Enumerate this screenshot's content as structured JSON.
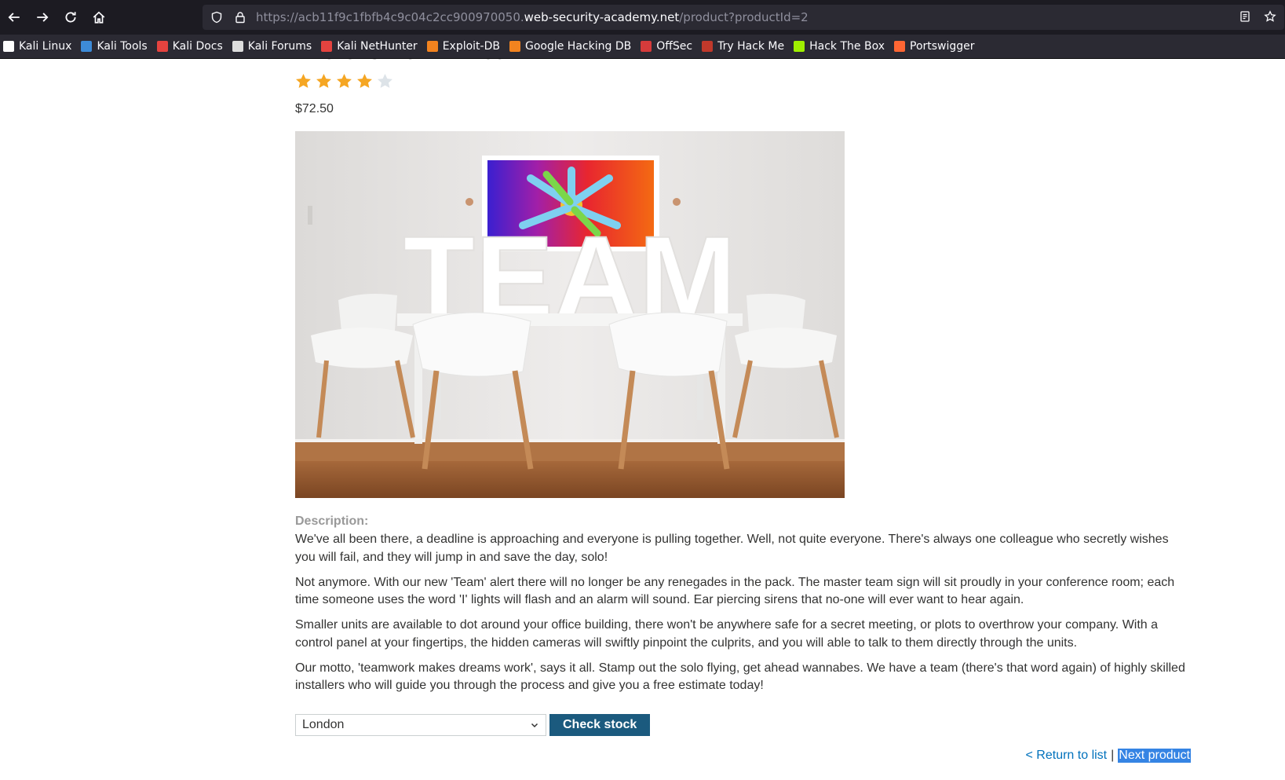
{
  "browser": {
    "url_prefix": "https://acb11f9c1fbfb4c9c04c2cc900970050.",
    "url_host": "web-security-academy.net",
    "url_path": "/product?productId=2",
    "bookmarks": [
      {
        "label": "Kali Linux",
        "color": "#ffffff"
      },
      {
        "label": "Kali Tools",
        "color": "#3d8bd8"
      },
      {
        "label": "Kali Docs",
        "color": "#e5433f"
      },
      {
        "label": "Kali Forums",
        "color": "#dddddd"
      },
      {
        "label": "Kali NetHunter",
        "color": "#e5433f"
      },
      {
        "label": "Exploit-DB",
        "color": "#f2831f"
      },
      {
        "label": "Google Hacking DB",
        "color": "#f2831f"
      },
      {
        "label": "OffSec",
        "color": "#d63b3b"
      },
      {
        "label": "Try Hack Me",
        "color": "#c0392b"
      },
      {
        "label": "Hack The Box",
        "color": "#9fef00"
      },
      {
        "label": "Portswigger",
        "color": "#ff6633"
      }
    ]
  },
  "product": {
    "title": "There is No 'I' in Team",
    "rating": 4,
    "rating_max": 5,
    "price": "$72.50",
    "image_text": "TEAM",
    "description_label": "Description:",
    "description": [
      "We've all been there, a deadline is approaching and everyone is pulling together. Well, not quite everyone. There's always one colleague who secretly wishes you will fail, and they will jump in and save the day, solo!",
      "Not anymore. With our new 'Team' alert there will no longer be any renegades in the pack. The master team sign will sit proudly in your conference room; each time someone uses the word 'I' lights will flash and an alarm will sound. Ear piercing sirens that no-one will ever want to hear again.",
      "Smaller units are available to dot around your office building, there won't be anywhere safe for a secret meeting, or plots to overthrow your company. With a control panel at your fingertips, the hidden cameras will swiftly pinpoint the culprits, and you will able to talk to them directly through the units.",
      "Our motto, 'teamwork makes dreams work', says it all. Stamp out the solo flying, get ahead wannabes. We have a team (there's that word again) of highly skilled installers who will guide you through the process and give you a free estimate today!"
    ]
  },
  "stock": {
    "selected_store": "London",
    "check_label": "Check stock"
  },
  "footer": {
    "return_label": "< Return to list",
    "separator": "|",
    "next_label": "Next product"
  },
  "colors": {
    "star_filled": "#f5a623",
    "star_empty": "#dde3e8",
    "button": "#1b5a7e",
    "link": "#0071bc"
  }
}
